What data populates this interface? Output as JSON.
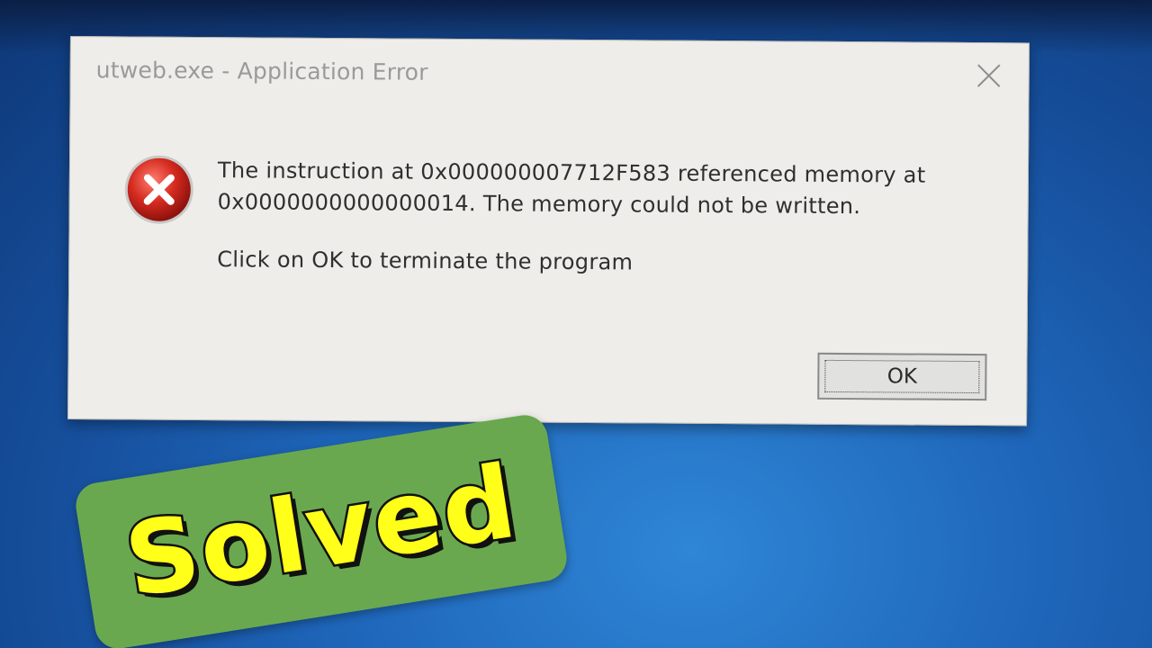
{
  "dialog": {
    "title": "utweb.exe - Application Error",
    "icons": {
      "close": "close-icon",
      "error": "error-icon"
    },
    "message_line1": "The instruction at 0x000000007712F583 referenced memory at",
    "message_line2": "0x0000000000000014. The memory could not be written.",
    "message_line3": "Click on OK to terminate the program",
    "ok_label": "OK"
  },
  "overlay": {
    "badge_text": "Solved",
    "badge_color": "#6aa84f",
    "text_color": "#ffff1a"
  },
  "colors": {
    "desktop": "#1f67bb",
    "dialog_bg": "#eeedea",
    "error_red": "#d42a20"
  }
}
